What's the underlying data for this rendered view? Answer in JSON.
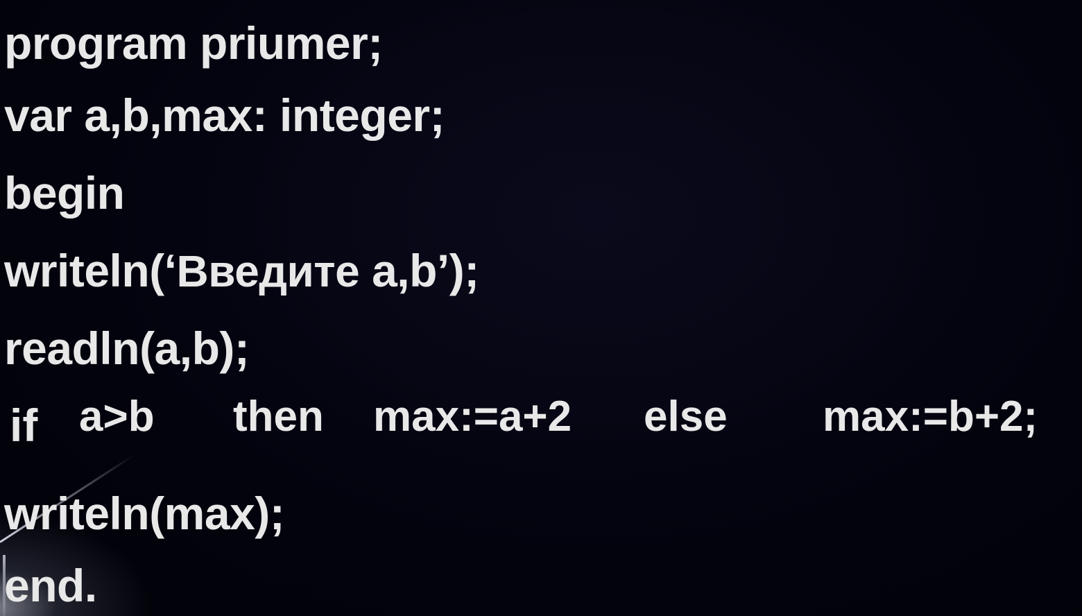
{
  "code": {
    "line1": "program priumer;",
    "line2": "var a,b,max: integer;",
    "line3": "begin",
    "line4_prefix": "writeln(‘",
    "line4_string": "Введите",
    "line4_suffix": " a,b’);",
    "line5": "readln(a,b);",
    "if_keyword": "if",
    "if_condition": "a>b",
    "then_keyword": "then",
    "then_statement": "max:=a+2",
    "else_keyword": "else",
    "else_statement": "max:=b+2;",
    "line7": "writeln(max);",
    "line8": "end."
  },
  "colors": {
    "background": "#03030e",
    "text": "#e8e8e8"
  }
}
